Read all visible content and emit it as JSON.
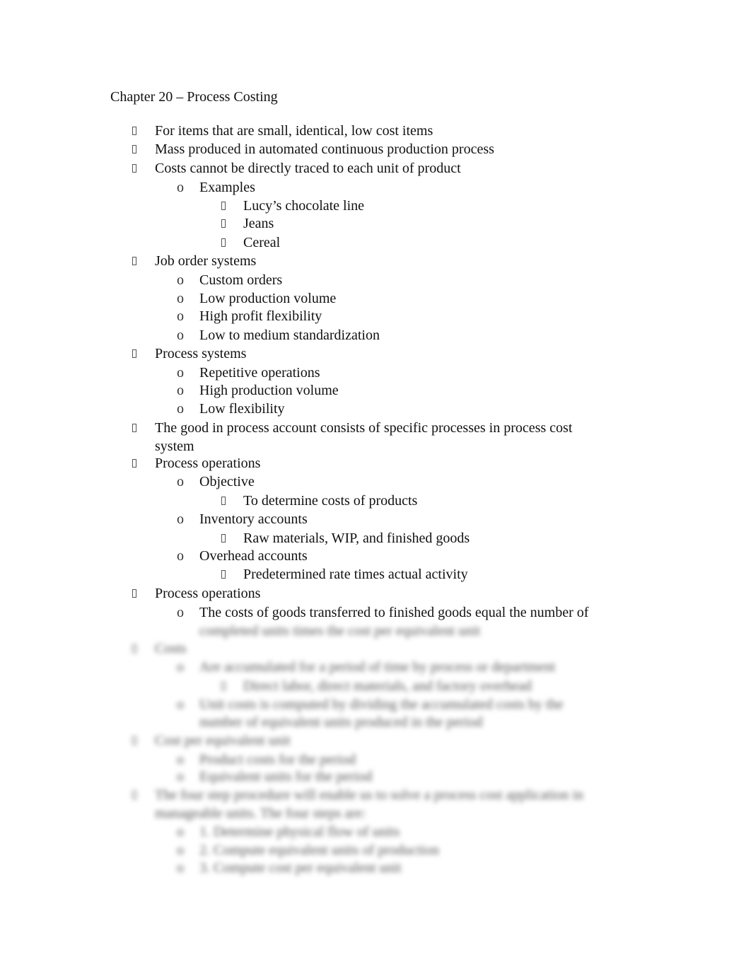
{
  "document": {
    "title": "Chapter 20 – Process Costing",
    "bullet_glyphs": {
      "level1": "missing-glyph-square",
      "level2": "o",
      "level3": "missing-glyph-square"
    },
    "lines": [
      {
        "level": 1,
        "text": "For items that are small, identical, low cost items"
      },
      {
        "level": 1,
        "text": "Mass produced in automated continuous production process"
      },
      {
        "level": 1,
        "text": "Costs cannot be directly traced to each unit of product"
      },
      {
        "level": 2,
        "text": "Examples"
      },
      {
        "level": 3,
        "text": "Lucy’s chocolate line"
      },
      {
        "level": 3,
        "text": "Jeans"
      },
      {
        "level": 3,
        "text": "Cereal"
      },
      {
        "level": 1,
        "text": "Job order systems"
      },
      {
        "level": 2,
        "text": "Custom orders"
      },
      {
        "level": 2,
        "text": "Low production volume"
      },
      {
        "level": 2,
        "text": "High profit flexibility"
      },
      {
        "level": 2,
        "text": "Low to medium standardization"
      },
      {
        "level": 1,
        "text": "Process systems"
      },
      {
        "level": 2,
        "text": "Repetitive operations"
      },
      {
        "level": 2,
        "text": "High production volume"
      },
      {
        "level": 2,
        "text": "Low flexibility"
      },
      {
        "level": 1,
        "text": "The good in process account consists of specific processes in process cost"
      },
      {
        "level": 1,
        "continuation": true,
        "text": "system"
      },
      {
        "level": 1,
        "text": "Process operations"
      },
      {
        "level": 2,
        "text": "Objective"
      },
      {
        "level": 3,
        "text": "To determine costs of products"
      },
      {
        "level": 2,
        "text": "Inventory accounts"
      },
      {
        "level": 3,
        "text": "Raw materials, WIP, and finished goods"
      },
      {
        "level": 2,
        "text": "Overhead accounts"
      },
      {
        "level": 3,
        "text": "Predetermined rate times actual activity"
      },
      {
        "level": 1,
        "text": "Process operations"
      },
      {
        "level": 2,
        "text": "The costs of goods transferred to finished goods equal the number of"
      }
    ],
    "blurred_lines": [
      {
        "level": 2,
        "continuation": true,
        "text": "completed units times the cost per equivalent unit"
      },
      {
        "level": 1,
        "text": "Costs"
      },
      {
        "level": 2,
        "text": "Are accumulated for a period of time by process or department"
      },
      {
        "level": 3,
        "text": "Direct labor, direct materials, and factory overhead"
      },
      {
        "level": 2,
        "text": "Unit costs is computed by dividing the accumulated costs by the"
      },
      {
        "level": 2,
        "continuation": true,
        "text": "number of equivalent units produced in the period"
      },
      {
        "level": 1,
        "text": "Cost per equivalent unit"
      },
      {
        "level": 2,
        "text": "Product costs for the period"
      },
      {
        "level": 2,
        "text": "Equivalent units for the period"
      },
      {
        "level": 1,
        "text": "The four step procedure will enable us to solve a process cost application in"
      },
      {
        "level": 1,
        "continuation": true,
        "text": "manageable units. The four steps are:"
      },
      {
        "level": 2,
        "text": "1.  Determine physical flow of units"
      },
      {
        "level": 2,
        "text": "2.  Compute equivalent units of production"
      },
      {
        "level": 2,
        "text": "3.  Compute cost per equivalent unit"
      }
    ]
  }
}
